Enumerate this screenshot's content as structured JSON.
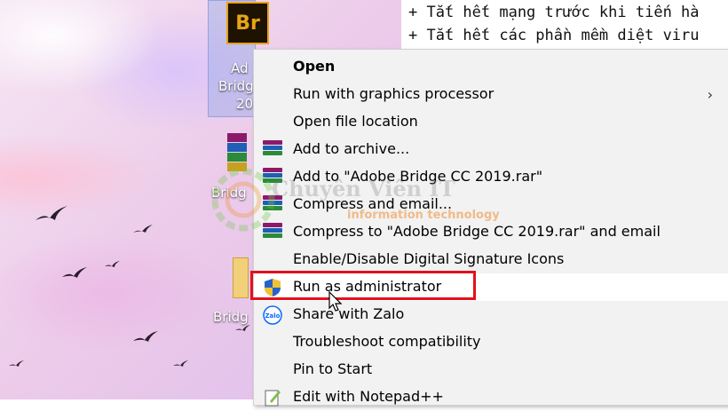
{
  "top_text": {
    "line1": "+ Tắt hết mạng trước khi tiến hà",
    "line2": "+ Tắt hết các phần mềm diệt viru"
  },
  "desktop": {
    "br_logo_text": "Br",
    "icons": [
      {
        "label": "Ad",
        "icon": "adobe-bridge-icon"
      },
      {
        "label": "Bridge",
        "icon": "adobe-bridge-icon"
      },
      {
        "label": "20",
        "icon": "adobe-bridge-icon"
      },
      {
        "label": "Bridg",
        "icon": "winrar-archive-icon"
      },
      {
        "label": "Bridg",
        "icon": "folder-icon"
      }
    ]
  },
  "watermark": {
    "title": "Chuyên Viên IT",
    "subtitle": "information technology"
  },
  "context_menu": {
    "items": [
      {
        "label": "Open",
        "bold": true,
        "icon": null
      },
      {
        "label": "Run with graphics processor",
        "submenu": true,
        "icon": null
      },
      {
        "label": "Open file location",
        "icon": null
      },
      {
        "label": "Add to archive...",
        "icon": "winrar-icon"
      },
      {
        "label": "Add to \"Adobe Bridge CC 2019.rar\"",
        "icon": "winrar-icon"
      },
      {
        "label": "Compress and email...",
        "icon": "winrar-icon"
      },
      {
        "label": "Compress to \"Adobe Bridge CC 2019.rar\" and email",
        "icon": "winrar-icon"
      },
      {
        "label": "Enable/Disable Digital Signature Icons",
        "icon": null
      },
      {
        "label": "Run as administrator",
        "icon": "uac-shield-icon",
        "highlighted": true
      },
      {
        "label": "Share with Zalo",
        "icon": "zalo-icon"
      },
      {
        "label": "Troubleshoot compatibility",
        "icon": null
      },
      {
        "label": "Pin to Start",
        "icon": null
      },
      {
        "label": "Edit with Notepad++",
        "icon": "notepad-plus-plus-icon"
      }
    ],
    "submenu_arrow": "›"
  },
  "colors": {
    "highlight_box": "#e3101d",
    "menu_bg": "#f2f2f2"
  }
}
